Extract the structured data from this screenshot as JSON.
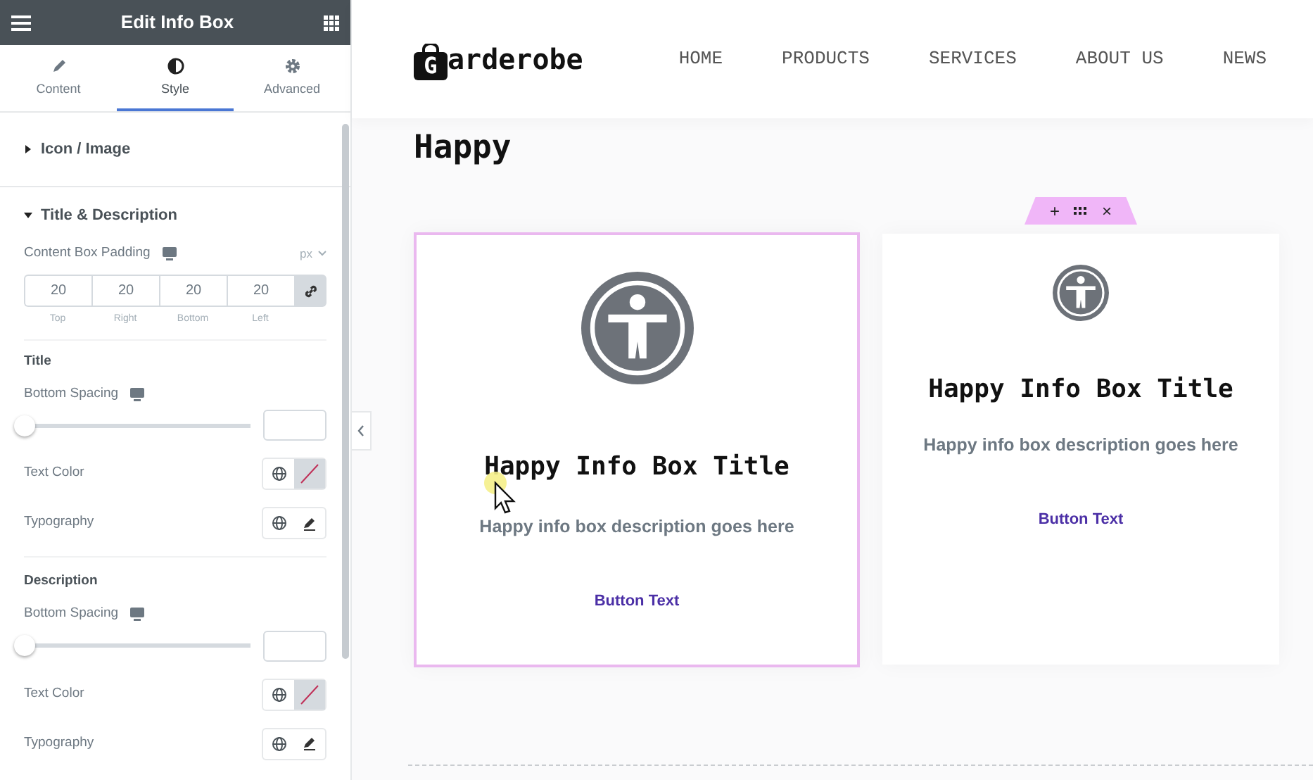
{
  "panel": {
    "title": "Edit Info Box",
    "tabs": [
      {
        "label": "Content",
        "selected": false
      },
      {
        "label": "Style",
        "selected": true
      },
      {
        "label": "Advanced",
        "selected": false
      }
    ],
    "sections": [
      {
        "label": "Icon / Image",
        "expanded": false
      },
      {
        "label": "Title & Description",
        "expanded": true,
        "controls": [
          {
            "kind": "dimensions",
            "label": "Content Box Padding",
            "unit": "px",
            "linked": true,
            "values": [
              {
                "value": "20",
                "label": "Top"
              },
              {
                "value": "20",
                "label": "Right"
              },
              {
                "value": "20",
                "label": "Bottom"
              },
              {
                "value": "20",
                "label": "Left"
              }
            ]
          },
          {
            "kind": "heading",
            "label": "Title"
          },
          {
            "kind": "slider",
            "label": "Bottom Spacing",
            "level": 0
          },
          {
            "kind": "color",
            "label": "Text Color"
          },
          {
            "kind": "typography",
            "label": "Typography"
          },
          {
            "kind": "heading",
            "label": "Description"
          },
          {
            "kind": "slider",
            "label": "Bottom Spacing",
            "level": 0
          },
          {
            "kind": "color",
            "label": "Text Color"
          },
          {
            "kind": "typography",
            "label": "Typography"
          }
        ]
      }
    ]
  },
  "site": {
    "logo": {
      "initial": "G",
      "rest": "arderobe"
    },
    "nav": [
      "HOME",
      "PRODUCTS",
      "SERVICES",
      "ABOUT US",
      "NEWS"
    ],
    "heading": "Happy",
    "cards": [
      {
        "selected": true,
        "toolbar": false,
        "kind": "large-icon",
        "title": "Happy Info Box Title",
        "description": "Happy info box description goes here",
        "button": "Button Text"
      },
      {
        "selected": false,
        "toolbar": true,
        "kind": "small-icon",
        "title": "Happy Info Box Title",
        "description": "Happy info box description goes here",
        "button": "Button Text"
      }
    ]
  },
  "toolbar": {
    "add": "+",
    "close": "×"
  }
}
